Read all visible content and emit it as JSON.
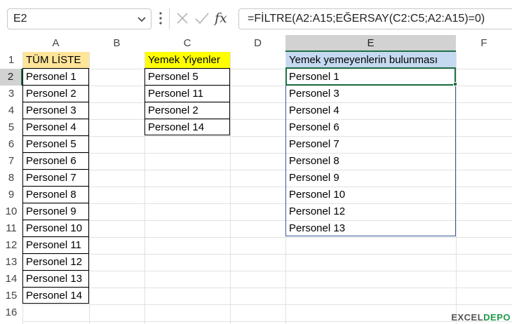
{
  "formula_bar": {
    "name_box": "E2",
    "fx_label": "fx",
    "formula": "=FİLTRE(A2:A15;EĞERSAY(C2:C5;A2:A15)=0)"
  },
  "columns": [
    "A",
    "B",
    "C",
    "D",
    "E",
    "F"
  ],
  "rows": [
    "1",
    "2",
    "3",
    "4",
    "5",
    "6",
    "7",
    "8",
    "9",
    "10",
    "11",
    "12",
    "13",
    "14",
    "15",
    "16"
  ],
  "sheet": {
    "A1": "TÜM LİSTE",
    "A": [
      "Personel 1",
      "Personel 2",
      "Personel 3",
      "Personel 4",
      "Personel 5",
      "Personel 6",
      "Personel 7",
      "Personel 8",
      "Personel 9",
      "Personel 10",
      "Personel 11",
      "Personel 12",
      "Personel 13",
      "Personel 14"
    ],
    "C1": "Yemek Yiyenler",
    "C": [
      "Personel 5",
      "Personel 11",
      "Personel 2",
      "Personel 14"
    ],
    "E1": "Yemek yemeyenlerin bulunması",
    "E": [
      "Personel 1",
      "Personel 3",
      "Personel 4",
      "Personel 6",
      "Personel 7",
      "Personel 8",
      "Personel 9",
      "Personel 10",
      "Personel 12",
      "Personel 13"
    ]
  },
  "colors": {
    "header_A": "#ffe599",
    "header_C": "#ffff00",
    "header_E": "#c5d9f1",
    "selection": "#1e7145"
  },
  "watermark": {
    "left": "EXCEL",
    "right": "DEPO"
  }
}
